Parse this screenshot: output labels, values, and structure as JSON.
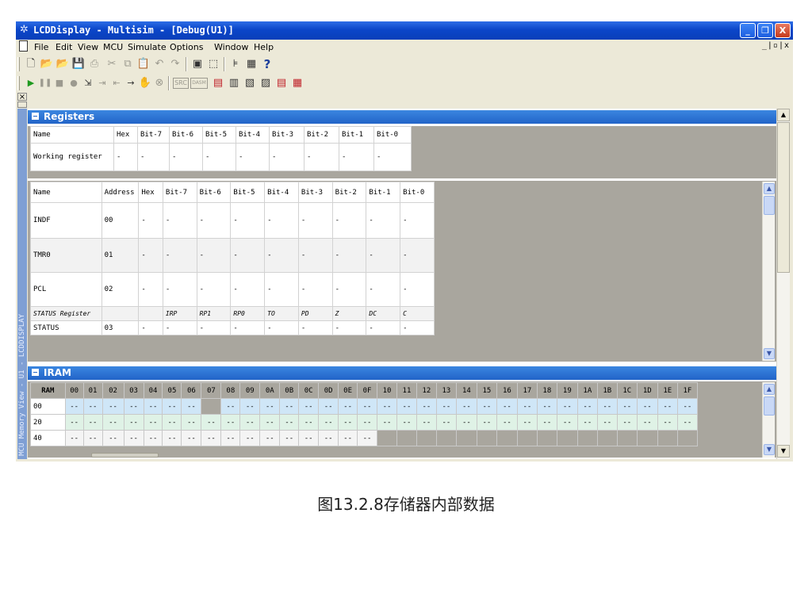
{
  "window": {
    "title": "LCDDisplay - Multisim - [Debug(U1)]",
    "controls": [
      "_",
      "❐",
      "X"
    ]
  },
  "menu": {
    "items": [
      "File",
      "Edit",
      "View",
      "MCU",
      "Simulate",
      "Options",
      "Window",
      "Help"
    ],
    "mdi_controls": "_|▫|x"
  },
  "toolbar1": [
    "new-icon",
    "open-icon",
    "open-sample-icon",
    "save-icon",
    "print-icon",
    "cut-icon",
    "copy-icon",
    "paste-icon",
    "undo-icon",
    "redo-icon",
    "component-icon",
    "fullscreen-icon",
    "hierarchy-icon",
    "grid-icon",
    "help-icon"
  ],
  "toolbar2": [
    "run-icon",
    "pause-icon",
    "stop-icon",
    "breakpoint-icon",
    "step-into-icon",
    "step-over-icon",
    "step-out-icon",
    "run-to-cursor-icon",
    "toggle-breakpoint-icon",
    "remove-breakpoints-icon",
    "src-view-icon",
    "disasm-view-icon",
    "memory-view-icon",
    "register-view-icon",
    "io-view-icon",
    "watch-view-icon",
    "call-stack-icon",
    "mixed-view-icon"
  ],
  "toolbar2_labels": {
    "src": "SRC",
    "disasm": "DASM"
  },
  "left_panel": {
    "label": "MCU Memory View - U1 - LCDDISPLAY"
  },
  "registers": {
    "title": "Registers",
    "working_headers": [
      "Name",
      "Hex",
      "Bit-7",
      "Bit-6",
      "Bit-5",
      "Bit-4",
      "Bit-3",
      "Bit-2",
      "Bit-1",
      "Bit-0"
    ],
    "working_row": [
      "Working register",
      "-",
      "-",
      "-",
      "-",
      "-",
      "-",
      "-",
      "-",
      "-"
    ],
    "sfr_headers": [
      "Name",
      "Address",
      "Hex",
      "Bit-7",
      "Bit-6",
      "Bit-5",
      "Bit-4",
      "Bit-3",
      "Bit-2",
      "Bit-1",
      "Bit-0"
    ],
    "sfr_rows": [
      [
        "INDF",
        "00",
        "-",
        "-",
        "-",
        "-",
        "-",
        "-",
        "-",
        "-",
        "-"
      ],
      [
        "TMR0",
        "01",
        "-",
        "-",
        "-",
        "-",
        "-",
        "-",
        "-",
        "-",
        "-"
      ],
      [
        "PCL",
        "02",
        "-",
        "-",
        "-",
        "-",
        "-",
        "-",
        "-",
        "-",
        "-"
      ]
    ],
    "status_bits_row": [
      "STATUS Register",
      "",
      "",
      "IRP",
      "RP1",
      "RP0",
      "TO",
      "PD",
      "Z",
      "DC",
      "C"
    ],
    "status_row": [
      "STATUS",
      "03",
      "-",
      "-",
      "-",
      "-",
      "-",
      "-",
      "-",
      "-",
      "-"
    ]
  },
  "iram": {
    "title": "IRAM",
    "corner": "RAM",
    "columns": [
      "00",
      "01",
      "02",
      "03",
      "04",
      "05",
      "06",
      "07",
      "08",
      "09",
      "0A",
      "0B",
      "0C",
      "0D",
      "0E",
      "0F",
      "10",
      "11",
      "12",
      "13",
      "14",
      "15",
      "16",
      "17",
      "18",
      "19",
      "1A",
      "1B",
      "1C",
      "1D",
      "1E",
      "1F"
    ],
    "rows": [
      {
        "label": "00",
        "cells": [
          "--",
          "--",
          "--",
          "--",
          "--",
          "--",
          "--",
          "",
          "--",
          "--",
          "--",
          "--",
          "--",
          "--",
          "--",
          "--",
          "--",
          "--",
          "--",
          "--",
          "--",
          "--",
          "--",
          "--",
          "--",
          "--",
          "--",
          "--",
          "--",
          "--",
          "--",
          "--"
        ]
      },
      {
        "label": "20",
        "cells": [
          "--",
          "--",
          "--",
          "--",
          "--",
          "--",
          "--",
          "--",
          "--",
          "--",
          "--",
          "--",
          "--",
          "--",
          "--",
          "--",
          "--",
          "--",
          "--",
          "--",
          "--",
          "--",
          "--",
          "--",
          "--",
          "--",
          "--",
          "--",
          "--",
          "--",
          "--",
          "--"
        ]
      },
      {
        "label": "40",
        "cells": [
          "--",
          "--",
          "--",
          "--",
          "--",
          "--",
          "--",
          "--",
          "--",
          "--",
          "--",
          "--",
          "--",
          "--",
          "--",
          "--",
          "",
          "",
          "",
          "",
          "",
          "",
          "",
          "",
          "",
          "",
          "",
          "",
          "",
          "",
          "",
          ""
        ]
      }
    ]
  },
  "caption": "图13.2.8存储器内部数据"
}
